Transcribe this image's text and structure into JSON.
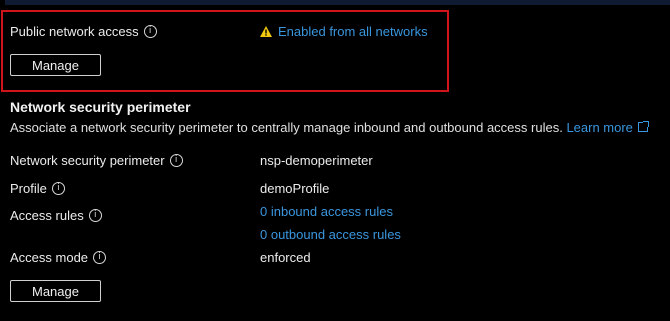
{
  "public_access": {
    "label": "Public network access",
    "status_text": "Enabled from all networks",
    "manage_label": "Manage"
  },
  "nsp": {
    "heading": "Network security perimeter",
    "description": "Associate a network security perimeter to centrally manage inbound and outbound access rules.",
    "learn_more": "Learn more",
    "rows": {
      "perimeter": {
        "label": "Network security perimeter",
        "value": "nsp-demoperimeter"
      },
      "profile": {
        "label": "Profile",
        "value": "demoProfile"
      },
      "access_rules": {
        "label": "Access rules",
        "inbound": "0 inbound access rules",
        "outbound": "0 outbound access rules"
      },
      "access_mode": {
        "label": "Access mode",
        "value": "enforced"
      }
    },
    "manage_label": "Manage"
  },
  "icons": {
    "info": "info-icon",
    "warning": "warning-icon",
    "external": "external-link-icon"
  },
  "colors": {
    "link": "#3a96dd",
    "warning": "#f2c811",
    "highlight": "#d0141b",
    "background": "#000000"
  }
}
